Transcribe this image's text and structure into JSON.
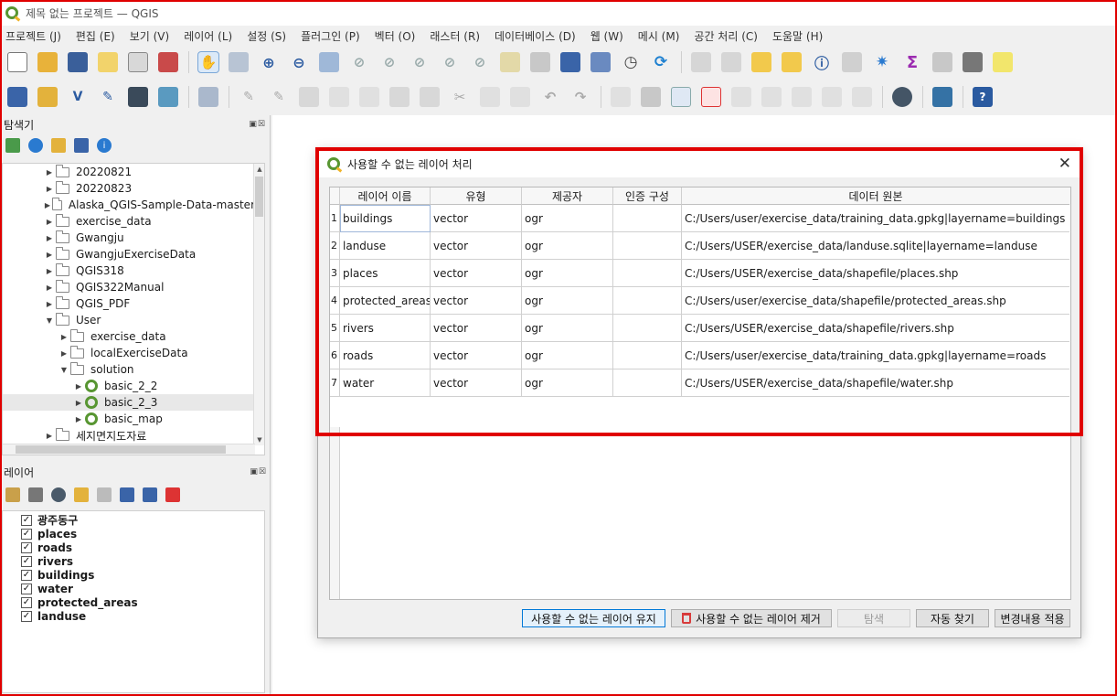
{
  "window": {
    "title": "제목 없는 프로젝트 — QGIS"
  },
  "menu": [
    "프로젝트 (J)",
    "편집 (E)",
    "보기 (V)",
    "레이어 (L)",
    "설정 (S)",
    "플러그인 (P)",
    "벡터 (O)",
    "래스터 (R)",
    "데이터베이스 (D)",
    "웹 (W)",
    "메시 (M)",
    "공간 처리 (C)",
    "도움말 (H)"
  ],
  "browser_panel": {
    "title": "탐색기",
    "nodes": [
      {
        "label": "20220821",
        "type": "folder",
        "depth": 1,
        "expanded": false
      },
      {
        "label": "20220823",
        "type": "folder",
        "depth": 1,
        "expanded": false
      },
      {
        "label": "Alaska_QGIS-Sample-Data-master",
        "type": "folder",
        "depth": 1,
        "expanded": false
      },
      {
        "label": "exercise_data",
        "type": "folder",
        "depth": 1,
        "expanded": false
      },
      {
        "label": "Gwangju",
        "type": "folder",
        "depth": 1,
        "expanded": false
      },
      {
        "label": "GwangjuExerciseData",
        "type": "folder",
        "depth": 1,
        "expanded": false
      },
      {
        "label": "QGIS318",
        "type": "folder",
        "depth": 1,
        "expanded": false
      },
      {
        "label": "QGIS322Manual",
        "type": "folder",
        "depth": 1,
        "expanded": false
      },
      {
        "label": "QGIS_PDF",
        "type": "folder",
        "depth": 1,
        "expanded": false
      },
      {
        "label": "User",
        "type": "folder",
        "depth": 1,
        "expanded": true
      },
      {
        "label": "exercise_data",
        "type": "folder",
        "depth": 2,
        "expanded": false
      },
      {
        "label": "localExerciseData",
        "type": "folder",
        "depth": 2,
        "expanded": false
      },
      {
        "label": "solution",
        "type": "folder",
        "depth": 2,
        "expanded": true
      },
      {
        "label": "basic_2_2",
        "type": "project",
        "depth": 3,
        "expanded": false
      },
      {
        "label": "basic_2_3",
        "type": "project",
        "depth": 3,
        "expanded": false,
        "highlighted": true
      },
      {
        "label": "basic_map",
        "type": "project",
        "depth": 3,
        "expanded": false
      },
      {
        "label": "세지면지도자료",
        "type": "folder",
        "depth": 1,
        "expanded": false
      }
    ]
  },
  "layers_panel": {
    "title": "레이어",
    "layers": [
      {
        "name": "광주동구",
        "checked": true
      },
      {
        "name": "places",
        "checked": true
      },
      {
        "name": "roads",
        "checked": true
      },
      {
        "name": "rivers",
        "checked": true
      },
      {
        "name": "buildings",
        "checked": true
      },
      {
        "name": "water",
        "checked": true
      },
      {
        "name": "protected_areas",
        "checked": true
      },
      {
        "name": "landuse",
        "checked": true
      }
    ]
  },
  "dialog": {
    "title": "사용할 수 없는 레이어 처리",
    "columns": [
      "레이어 이름",
      "유형",
      "제공자",
      "인증 구성",
      "데이터 원본"
    ],
    "rows": [
      {
        "num": "1",
        "name": "buildings",
        "type": "vector",
        "provider": "ogr",
        "auth": "",
        "source": "C:/Users/user/exercise_data/training_data.gpkg|layername=buildings"
      },
      {
        "num": "2",
        "name": "landuse",
        "type": "vector",
        "provider": "ogr",
        "auth": "",
        "source": "C:/Users/USER/exercise_data/landuse.sqlite|layername=landuse"
      },
      {
        "num": "3",
        "name": "places",
        "type": "vector",
        "provider": "ogr",
        "auth": "",
        "source": "C:/Users/USER/exercise_data/shapefile/places.shp"
      },
      {
        "num": "4",
        "name": "protected_areas",
        "type": "vector",
        "provider": "ogr",
        "auth": "",
        "source": "C:/Users/user/exercise_data/shapefile/protected_areas.shp"
      },
      {
        "num": "5",
        "name": "rivers",
        "type": "vector",
        "provider": "ogr",
        "auth": "",
        "source": "C:/Users/USER/exercise_data/shapefile/rivers.shp"
      },
      {
        "num": "6",
        "name": "roads",
        "type": "vector",
        "provider": "ogr",
        "auth": "",
        "source": "C:/Users/user/exercise_data/training_data.gpkg|layername=roads"
      },
      {
        "num": "7",
        "name": "water",
        "type": "vector",
        "provider": "ogr",
        "auth": "",
        "source": "C:/Users/USER/exercise_data/shapefile/water.shp"
      }
    ],
    "buttons": {
      "keep": "사용할 수 없는 레이어 유지",
      "remove": "사용할 수 없는 레이어 제거",
      "browse": "탐색",
      "auto_find": "자동 찾기",
      "apply": "변경내용 적용"
    }
  },
  "colors": {
    "highlight_border": "#e00000",
    "qgis_green": "#589632"
  }
}
